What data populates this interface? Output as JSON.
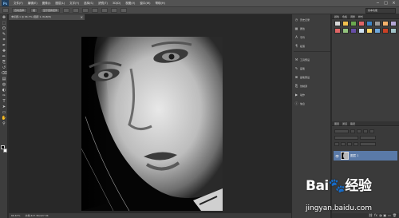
{
  "app": {
    "logo": "Ps"
  },
  "menubar": {
    "items": [
      "文件(F)",
      "编辑(E)",
      "图像(I)",
      "图层(L)",
      "文字(Y)",
      "选择(S)",
      "滤镜(T)",
      "3D(D)",
      "视图(V)",
      "窗口(W)",
      "帮助(H)"
    ],
    "controls": [
      "−",
      "□",
      "×"
    ]
  },
  "options_bar": {
    "items": [
      "自动选择:",
      "组",
      "显示变换控件"
    ],
    "workspace": "基本功能"
  },
  "document": {
    "tab_title": "未标题-1 @ 66.7% (图层 1, RGB/8)",
    "tab_close": "×"
  },
  "toolbox": {
    "tools": [
      "move-tool-icon",
      "marquee-tool-icon",
      "lasso-tool-icon",
      "quick-select-tool-icon",
      "crop-tool-icon",
      "eyedropper-tool-icon",
      "healing-brush-icon",
      "brush-tool-icon",
      "clone-stamp-icon",
      "history-brush-icon",
      "eraser-tool-icon",
      "gradient-tool-icon",
      "blur-tool-icon",
      "dodge-tool-icon",
      "pen-tool-icon",
      "type-tool-icon",
      "path-select-icon",
      "shape-tool-icon",
      "hand-tool-icon",
      "zoom-tool-icon"
    ],
    "glyphs": [
      "✥",
      "⬚",
      "ʘ",
      "✎",
      "⌗",
      "✒",
      "✚",
      "✏",
      "⎘",
      "↺",
      "⌫",
      "▤",
      "◍",
      "◐",
      "✑",
      "T",
      "➤",
      "▭",
      "✋",
      "⚲"
    ],
    "foreground_color": "#000000",
    "background_color": "#ffffff"
  },
  "panel_strip": {
    "items": [
      {
        "icon": "history-icon",
        "glyph": "◷",
        "label": "历史记录"
      },
      {
        "icon": "properties-icon",
        "glyph": "▦",
        "label": "属性"
      },
      {
        "icon": "character-icon",
        "glyph": "A",
        "label": "字符"
      },
      {
        "icon": "paragraph-icon",
        "glyph": "¶",
        "label": "段落"
      },
      {
        "icon": "tool-presets-icon",
        "glyph": "⚒",
        "label": "工具预设"
      },
      {
        "icon": "brush-icon",
        "glyph": "✎",
        "label": "画笔"
      },
      {
        "icon": "brush-presets-icon",
        "glyph": "⌘",
        "label": "画笔预设"
      },
      {
        "icon": "clone-source-icon",
        "glyph": "⎘",
        "label": "仿制源"
      },
      {
        "icon": "actions-icon",
        "glyph": "▶",
        "label": "动作"
      },
      {
        "icon": "info-icon",
        "glyph": "ⓘ",
        "label": "信息"
      }
    ]
  },
  "right_panels": {
    "top_tabs": [
      "颜色",
      "色板",
      "调整",
      "样式"
    ],
    "adjustment_tiles": [
      "#d9d9d9",
      "#f2c14e",
      "#6aa84f",
      "#e06666",
      "#3d85c6",
      "#999999",
      "#f6b26b",
      "#b4a7d6",
      "#e06666",
      "#93c47d",
      "#674ea7",
      "#cfe2f3",
      "#ffd966",
      "#6fa8dc",
      "#cc4125",
      "#a2c4c9"
    ],
    "layers_tabs": [
      "图层",
      "通道",
      "路径"
    ],
    "layers": [
      {
        "name": "图层 1",
        "visible": "👁"
      }
    ],
    "footer_icons": [
      "⛓",
      "fx",
      "◑",
      "▣",
      "▭",
      "🗑"
    ]
  },
  "statusbar": {
    "zoom": "66.67%",
    "doc_info": "文档:427.3K/427.3K"
  },
  "watermark": {
    "brand": "Bai🐾经验",
    "url": "jingyan.baidu.com"
  }
}
